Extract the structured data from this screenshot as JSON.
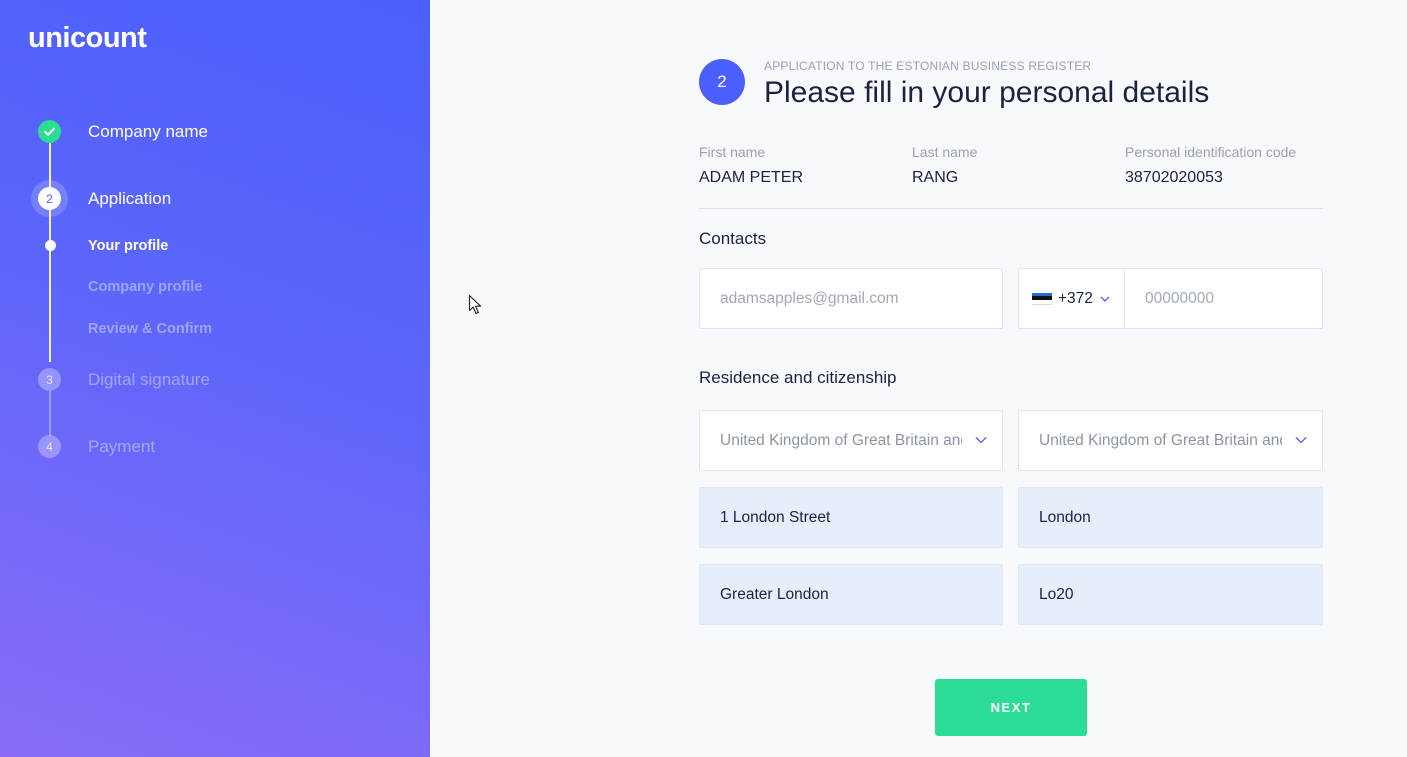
{
  "brand": {
    "logo": "unicount"
  },
  "sidebar": {
    "steps": [
      {
        "label": "Company name",
        "number": "",
        "state": "done"
      },
      {
        "label": "Application",
        "number": "2",
        "state": "active"
      },
      {
        "label": "Digital signature",
        "number": "3",
        "state": "pending"
      },
      {
        "label": "Payment",
        "number": "4",
        "state": "pending"
      }
    ],
    "substeps": [
      {
        "label": "Your profile",
        "state": "active"
      },
      {
        "label": "Company profile",
        "state": "pending"
      },
      {
        "label": "Review & Confirm",
        "state": "pending"
      }
    ]
  },
  "header": {
    "step_number": "2",
    "kicker": "APPLICATION TO THE ESTONIAN BUSINESS REGISTER",
    "title": "Please fill in your personal details"
  },
  "personal": {
    "first_name_label": "First name",
    "first_name": "ADAM PETER",
    "last_name_label": "Last name",
    "last_name": "RANG",
    "id_code_label": "Personal identification code",
    "id_code": "38702020053"
  },
  "contacts": {
    "title": "Contacts",
    "email_placeholder": "adamsapples@gmail.com",
    "phone_code": "+372",
    "phone_placeholder": "00000000"
  },
  "residence": {
    "title": "Residence and citizenship",
    "residence_country": "United Kingdom of Great Britain and Northern Ireland",
    "citizenship_country": "United Kingdom of Great Britain and Northern Ireland",
    "street": "1 London Street",
    "city": "London",
    "county": "Greater London",
    "postcode": "Lo20"
  },
  "actions": {
    "next_label": "NEXT"
  },
  "colors": {
    "accent": "#4a5ffb",
    "success": "#2bdc95",
    "title": "#1b2240"
  }
}
